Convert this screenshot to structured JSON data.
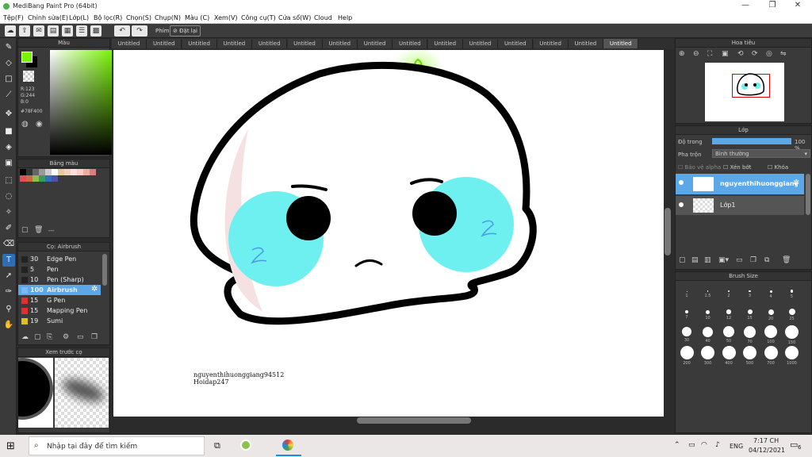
{
  "window": {
    "title": "MediBang Paint Pro (64bit)"
  },
  "menu": [
    "Tệp(F)",
    "Chỉnh sửa(E)",
    "Lớp(L)",
    "Bộ lọc(R)",
    "Chọn(S)",
    "Chụp(N)",
    "Màu (C)",
    "Xem(V)",
    "Công cụ(T)",
    "Cửa sổ(W)",
    "Cloud",
    "Help"
  ],
  "toolbar": {
    "phim_label": "Phím",
    "reset_label": "Đặt lại"
  },
  "color_panel": {
    "title": "Màu",
    "r": "R:123",
    "g": "G:244",
    "b": "B:0",
    "hex": "#78F400",
    "primary_color": "#78f400",
    "secondary_color": "#000000"
  },
  "palette_panel": {
    "title": "Bảng màu",
    "value": "---"
  },
  "brush_panel": {
    "title": "Cọ: Airbrush",
    "items": [
      {
        "size": "30",
        "name": "Edge Pen",
        "color": "#222222"
      },
      {
        "size": "5",
        "name": "Pen",
        "color": "#222222"
      },
      {
        "size": "10",
        "name": "Pen (Sharp)",
        "color": "#222222"
      },
      {
        "size": "100",
        "name": "Airbrush",
        "color": "#7fb8f0"
      },
      {
        "size": "15",
        "name": "G Pen",
        "color": "#e03030"
      },
      {
        "size": "15",
        "name": "Mapping Pen",
        "color": "#e03030"
      },
      {
        "size": "19",
        "name": "Sumi",
        "color": "#e0c020"
      }
    ]
  },
  "preview_panel": {
    "title": "Xem trước cọ"
  },
  "tabs": [
    "Untitled",
    "Untitled",
    "Untitled",
    "Untitled",
    "Untitled",
    "Untitled",
    "Untitled",
    "Untitled",
    "Untitled",
    "Untitled",
    "Untitled",
    "Untitled",
    "Untitled",
    "Untitled",
    "Untitled"
  ],
  "canvas": {
    "signature_line1": "nguyenthihuonggiang94512",
    "signature_line2": "Hoidap247"
  },
  "navigator_panel": {
    "title": "Hoa tiêu"
  },
  "layer_panel": {
    "title": "Lớp",
    "opacity_label": "Độ trong",
    "opacity_value": "100 %",
    "opacity_fraction": 1.0,
    "blend_label": "Pha trộn",
    "blend_value": "Bình thường",
    "protect_alpha": "Bảo vệ alpha",
    "clipping": "Xén bớt",
    "lock": "Khóa",
    "layers": [
      {
        "name": "nguyenthihuonggiang94512"
      },
      {
        "name": "Lớp1"
      }
    ]
  },
  "brushsize_panel": {
    "title": "Brush Size",
    "sizes": [
      "1",
      "1.5",
      "2",
      "3",
      "4",
      "5",
      "7",
      "10",
      "12",
      "15",
      "20",
      "25",
      "30",
      "40",
      "50",
      "70",
      "100",
      "150",
      "200",
      "300",
      "400",
      "500",
      "700",
      "1000"
    ]
  },
  "taskbar": {
    "search_placeholder": "Nhập tại đây để tìm kiếm",
    "lang": "ENG",
    "time": "7:17 CH",
    "date": "04/12/2021",
    "notif_count": "6"
  }
}
